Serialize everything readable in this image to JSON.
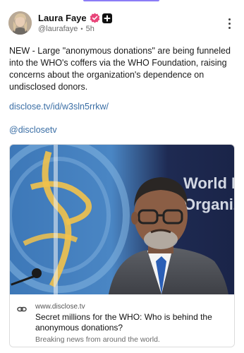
{
  "post": {
    "author": {
      "display_name": "Laura Faye",
      "handle": "@laurafaye",
      "time": "5h"
    },
    "text": "NEW - Large \"anonymous donations\" are being funneled into the WHO's coffers via the WHO Foundation, raising concerns about the organization's dependence on undisclosed donors.",
    "link": "disclose.tv/id/w3sln5rrkw/",
    "mention": "@disclosetv",
    "card": {
      "domain": "www.disclose.tv",
      "title": "Secret millions for the WHO: Who is behind the anonymous donations?",
      "description": "Breaking news from around the world.",
      "image_text": "World He Organiz"
    }
  },
  "icons": {
    "verified": "verified-badge-icon",
    "plus": "plus-badge-icon",
    "more": "more-vertical-icon",
    "link": "link-icon"
  },
  "colors": {
    "link": "#3a6ea5",
    "verified": "#e8457a",
    "accent": "#8b7cf6"
  }
}
